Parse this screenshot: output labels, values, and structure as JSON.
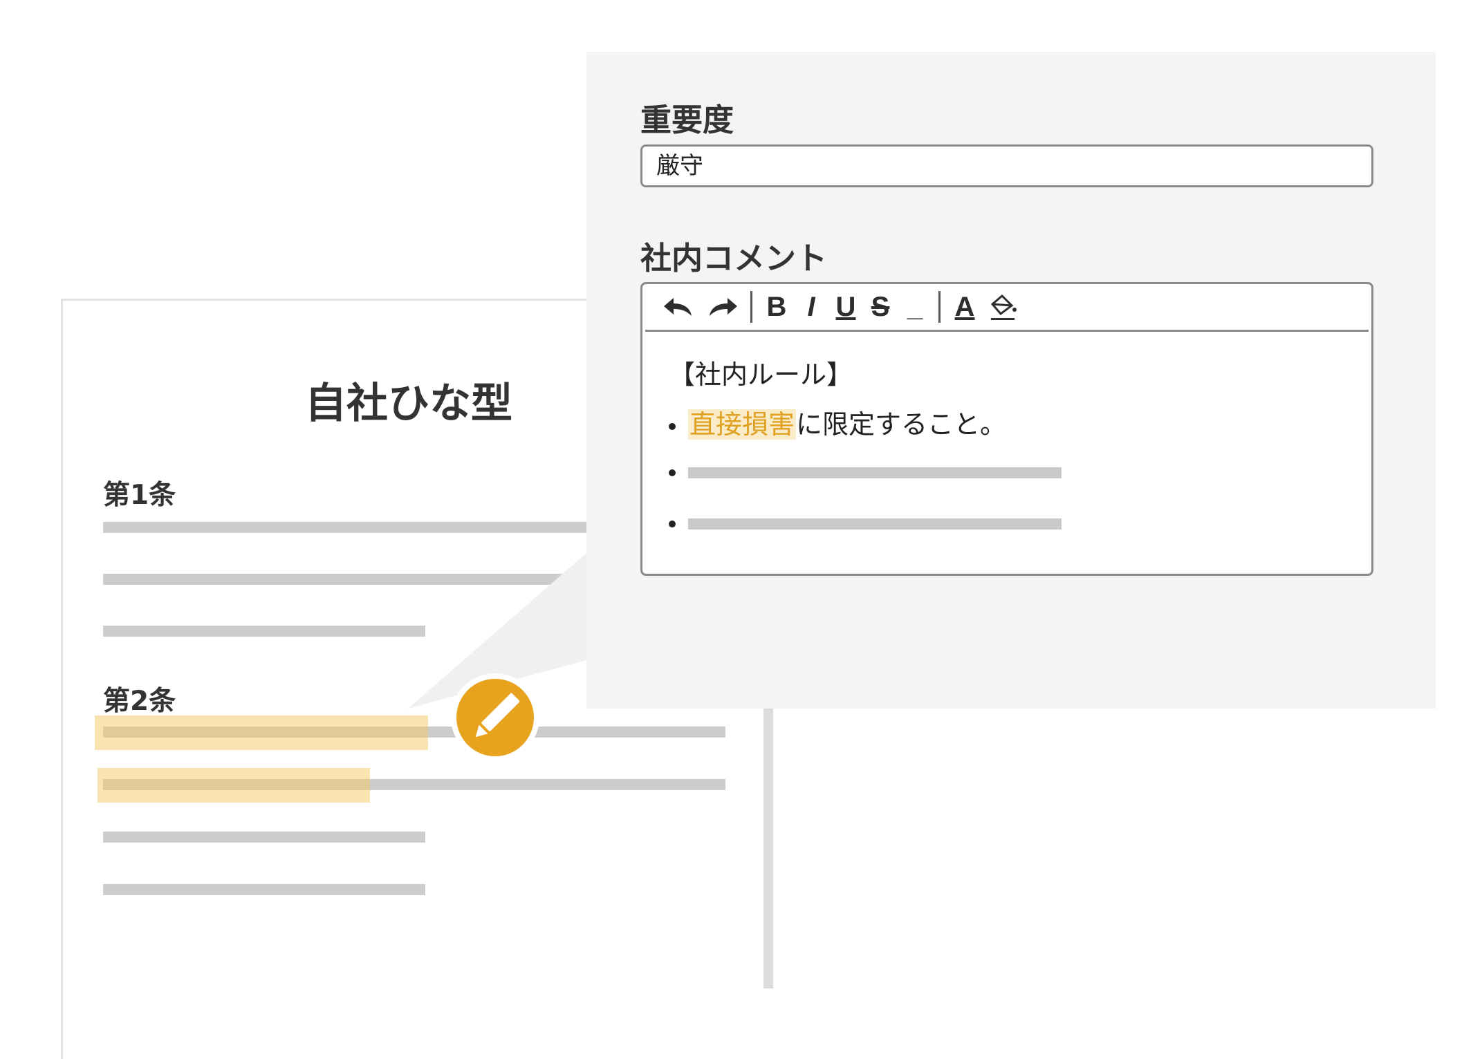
{
  "document": {
    "title": "自社ひな型",
    "articles": [
      {
        "label": "第1条"
      },
      {
        "label": "第2条"
      }
    ]
  },
  "panel": {
    "importance": {
      "label": "重要度",
      "value": "厳守"
    },
    "comment": {
      "label": "社内コメント",
      "toolbar": {
        "undo_icon": "undo-arrow-icon",
        "redo_icon": "redo-arrow-icon",
        "bold": "B",
        "italic": "I",
        "underline": "U",
        "strike": "S",
        "underscore": "_",
        "font_color": "A",
        "highlight_icon": "paint-bucket-icon"
      },
      "content": {
        "heading": "【社内ルール】",
        "bullet1_highlight": "直接損害",
        "bullet1_rest": "に限定すること。"
      }
    }
  },
  "colors": {
    "accent": "#e8a31e",
    "highlight": "#f2c764",
    "panel_bg": "#f4f4f4",
    "placeholder_line": "#cccccc"
  },
  "badge": {
    "icon": "pencil-icon"
  }
}
